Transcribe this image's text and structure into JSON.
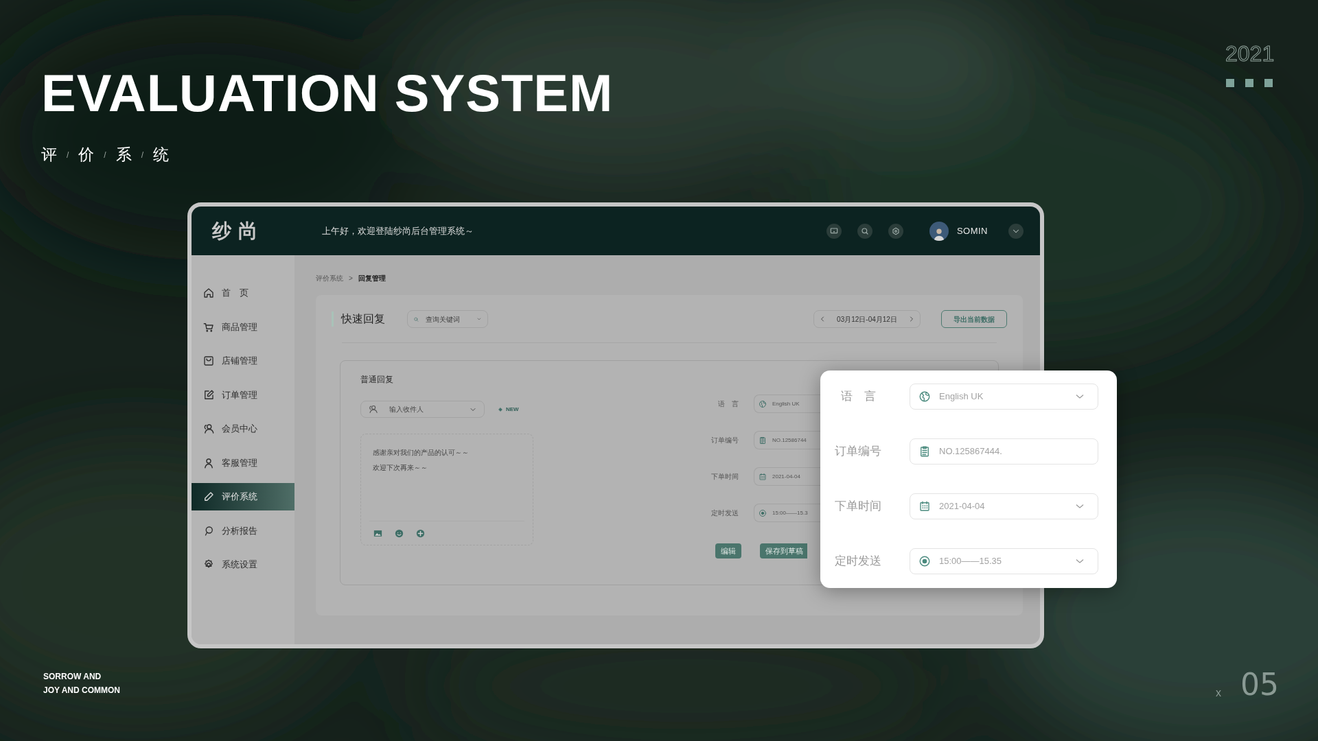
{
  "slide": {
    "title": "EVALUATION SYSTEM",
    "subtitle": [
      "评",
      "价",
      "系",
      "统"
    ],
    "separator": "/",
    "year": "2021",
    "footer": [
      "SORROW AND",
      "JOY AND COMMON"
    ],
    "page_marker": "x",
    "page_number": "05"
  },
  "app": {
    "logo": "纱尚",
    "greeting": "上午好，欢迎登陆纱尚后台管理系统～",
    "user": "SOMIN",
    "sidebar": [
      {
        "label": "首　页",
        "selected": false
      },
      {
        "label": "商品管理",
        "selected": false
      },
      {
        "label": "店铺管理",
        "selected": false
      },
      {
        "label": "订单管理",
        "selected": false
      },
      {
        "label": "会员中心",
        "selected": false
      },
      {
        "label": "客服管理",
        "selected": false
      },
      {
        "label": "评价系统",
        "selected": true
      },
      {
        "label": "分析报告",
        "selected": false
      },
      {
        "label": "系统设置",
        "selected": false
      }
    ],
    "breadcrumb": [
      "评价系统",
      "回复管理"
    ],
    "breadcrumb_separator": ">",
    "panel": {
      "title": "快速回复",
      "search": {
        "placeholder": "查询关键词"
      },
      "date_range": "03月12日-04月12日",
      "export_button": "导出当前数据"
    },
    "reply": {
      "title": "普通回复",
      "recipient": {
        "placeholder": "输入收件人"
      },
      "new_badge": "NEW",
      "message": [
        "感谢亲对我们的产品的认可～～",
        "欢迎下次再来～～"
      ],
      "form": [
        {
          "label": "语　言",
          "value": "English UK"
        },
        {
          "label": "订单编号",
          "value": "NO.12586744"
        },
        {
          "label": "下单时间",
          "value": "2021-04-04"
        },
        {
          "label": "定时发送",
          "value": "15:00——15.3"
        }
      ],
      "buttons": [
        "编辑",
        "保存到草稿"
      ]
    }
  },
  "popup": {
    "form": [
      {
        "label": "语　言",
        "value": "English UK",
        "dropdown": true
      },
      {
        "label": "订单编号",
        "value": "NO.125867444.",
        "dropdown": false
      },
      {
        "label": "下单时间",
        "value": "2021-04-04",
        "dropdown": true
      },
      {
        "label": "定时发送",
        "value": "15:00——15.35",
        "dropdown": true
      }
    ]
  }
}
